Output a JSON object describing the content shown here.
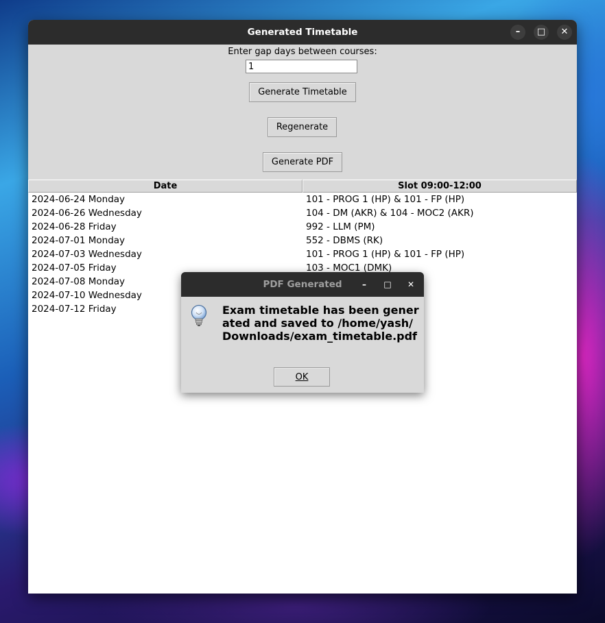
{
  "main_window": {
    "title": "Generated Timetable",
    "controls": {
      "minimize": "–",
      "maximize": "□",
      "close": "✕"
    },
    "gap_label": "Enter gap days between courses:",
    "gap_value": "1",
    "buttons": {
      "generate": "Generate Timetable",
      "regenerate": "Regenerate",
      "pdf": "Generate PDF"
    },
    "table": {
      "columns": [
        "Date",
        "Slot 09:00-12:00"
      ],
      "rows": [
        [
          "2024-06-24 Monday",
          "101 - PROG 1 (HP) & 101 - FP (HP)"
        ],
        [
          "2024-06-26 Wednesday",
          "104 - DM (AKR) & 104 - MOC2 (AKR)"
        ],
        [
          "2024-06-28 Friday",
          "992 - LLM (PM)"
        ],
        [
          "2024-07-01 Monday",
          "552 - DBMS (RK)"
        ],
        [
          "2024-07-03 Wednesday",
          "101 - PROG 1 (HP) & 101 - FP (HP)"
        ],
        [
          "2024-07-05 Friday",
          "103 - MOC1 (DMK)"
        ],
        [
          "2024-07-08 Monday",
          ""
        ],
        [
          "2024-07-10 Wednesday",
          ""
        ],
        [
          "2024-07-12 Friday",
          ""
        ]
      ]
    }
  },
  "dialog": {
    "title": "PDF Generated",
    "controls": {
      "minimize": "–",
      "maximize": "□",
      "close": "✕"
    },
    "icon": "lightbulb-icon",
    "message": "Exam timetable has been generated and saved to /home/yash/Downloads/exam_timetable.pdf",
    "ok_label": "OK"
  }
}
